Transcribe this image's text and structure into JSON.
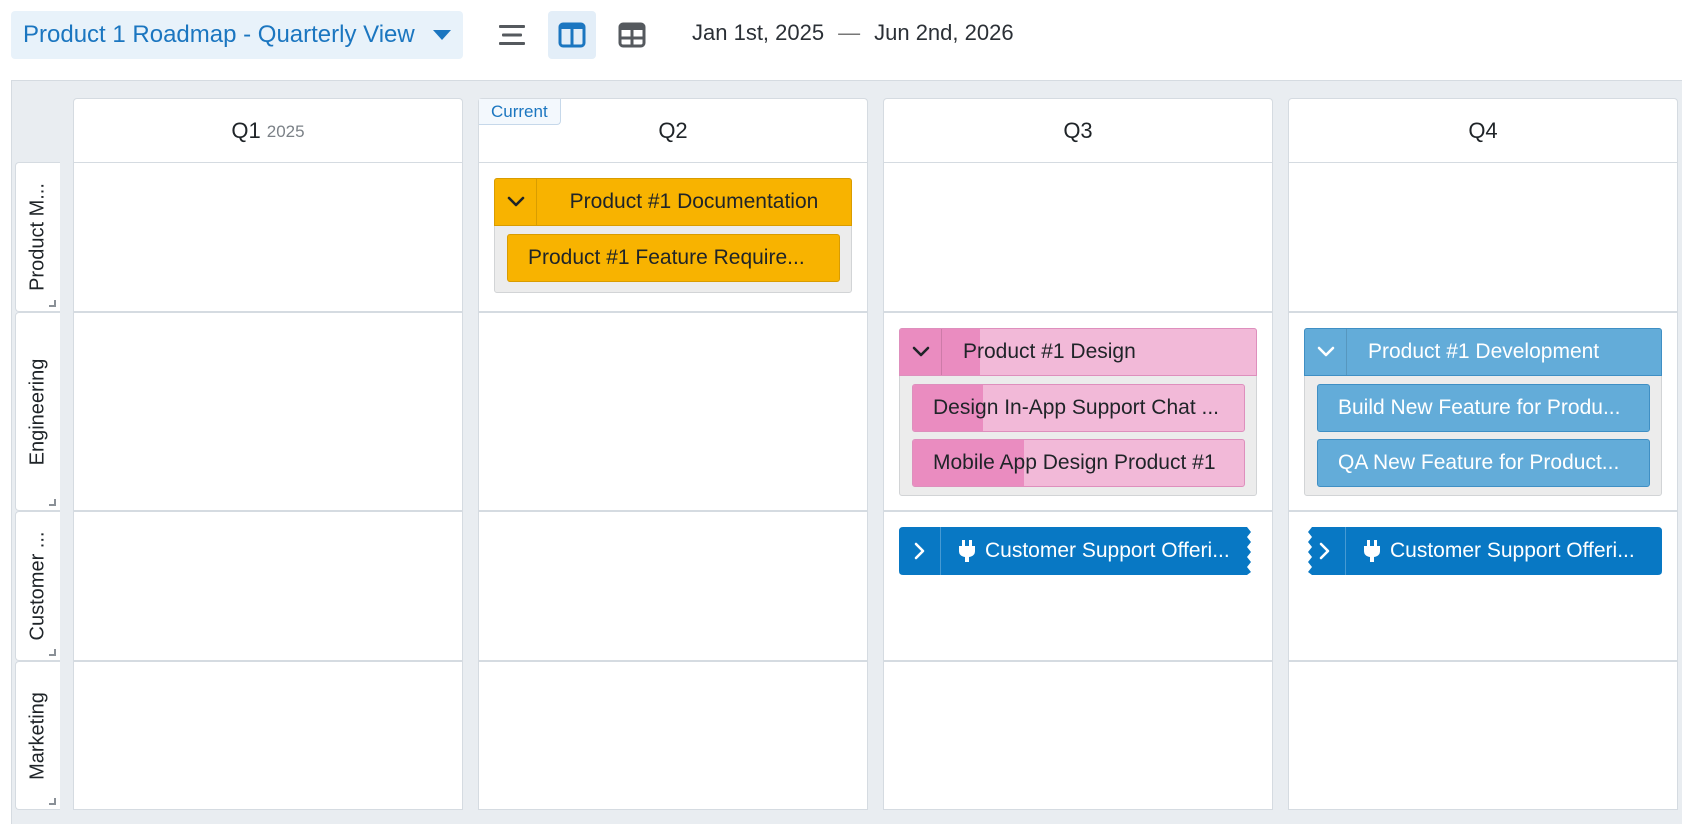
{
  "toolbar": {
    "view_title": "Product 1 Roadmap - Quarterly View",
    "views": [
      {
        "icon": "list-view-icon",
        "active": false
      },
      {
        "icon": "column-view-icon",
        "active": true
      },
      {
        "icon": "grid-view-icon",
        "active": false
      }
    ],
    "date_start": "Jan 1st, 2025",
    "date_sep": "—",
    "date_end": "Jun 2nd, 2026"
  },
  "columns": [
    {
      "label": "Q1",
      "year": "2025",
      "current": false
    },
    {
      "label": "Q2",
      "year": "",
      "current": true
    },
    {
      "label": "Q3",
      "year": "",
      "current": false
    },
    {
      "label": "Q4",
      "year": "",
      "current": false
    }
  ],
  "current_label": "Current",
  "rows": [
    {
      "label": "Product M..."
    },
    {
      "label": "Engineering"
    },
    {
      "label": "Customer ..."
    },
    {
      "label": "Marketing"
    }
  ],
  "cards": {
    "documentation": {
      "title": "Product #1 Documentation",
      "color": "#f8b300",
      "children": [
        {
          "title": "Product #1 Feature Require..."
        }
      ]
    },
    "design": {
      "title": "Product #1 Design",
      "color": "#f2b9d8",
      "progress": 0.22,
      "children": [
        {
          "title": "Design In-App Support Chat ...",
          "progress": 0.21
        },
        {
          "title": "Mobile App Design Product #1",
          "progress": 0.33
        }
      ]
    },
    "development": {
      "title": "Product #1 Development",
      "color": "#63acd9",
      "children": [
        {
          "title": "Build New Feature for Produ..."
        },
        {
          "title": "QA New Feature for Product..."
        }
      ]
    },
    "support_q3": {
      "title": "Customer Support Offeri...",
      "color": "#0878c4",
      "icon": "plug-icon"
    },
    "support_q4": {
      "title": "Customer Support Offeri...",
      "color": "#0878c4",
      "icon": "plug-icon"
    }
  }
}
